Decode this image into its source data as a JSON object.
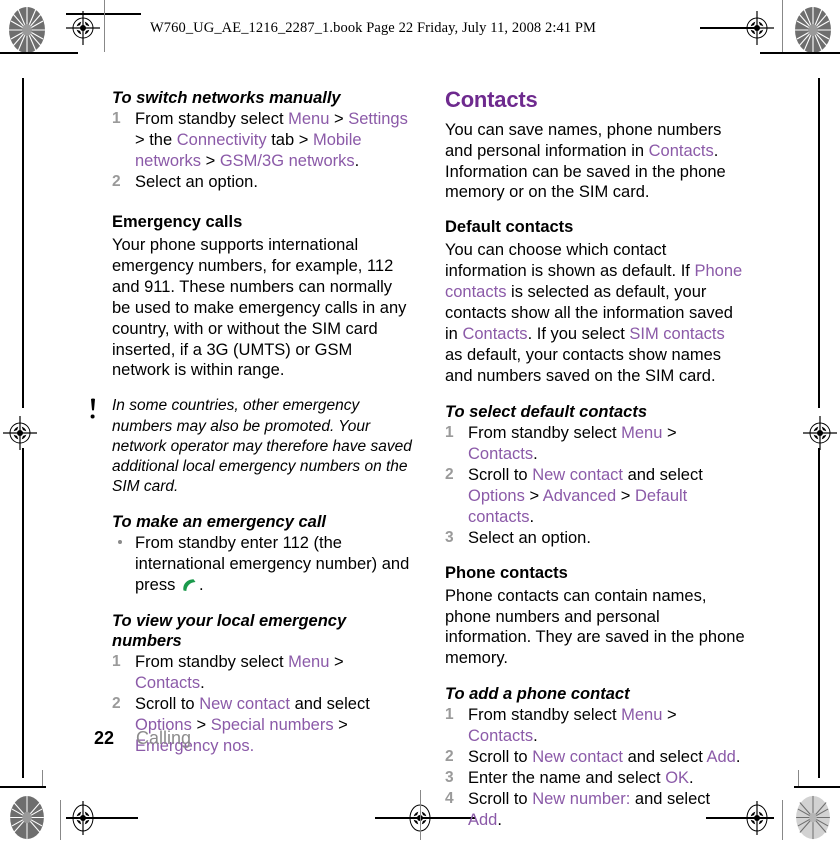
{
  "header": {
    "book_line": "W760_UG_AE_1216_2287_1.book  Page 22  Friday, July 11, 2008  2:41 PM"
  },
  "colors": {
    "heading_purple": "#6e2a8e",
    "link_purple": "#8b5aa8",
    "step_number_gray": "#9a9a9a",
    "footer_gray": "#8c8c8c",
    "call_icon_green": "#1a9a4b"
  },
  "left_column": {
    "proc_switch_networks": {
      "title": "To switch networks manually",
      "steps": [
        {
          "num": "1",
          "parts": [
            {
              "t": "From standby select ",
              "ui": false
            },
            {
              "t": "Menu",
              "ui": true
            },
            {
              "t": " > ",
              "ui": false
            },
            {
              "t": "Settings",
              "ui": true
            },
            {
              "t": " > the ",
              "ui": false
            },
            {
              "t": "Connectivity",
              "ui": true
            },
            {
              "t": " tab > ",
              "ui": false
            },
            {
              "t": "Mobile networks",
              "ui": true
            },
            {
              "t": " > ",
              "ui": false
            },
            {
              "t": "GSM/3G networks",
              "ui": true
            },
            {
              "t": ".",
              "ui": false
            }
          ]
        },
        {
          "num": "2",
          "parts": [
            {
              "t": "Select an option.",
              "ui": false
            }
          ]
        }
      ]
    },
    "emergency_calls": {
      "title": "Emergency calls",
      "body": "Your phone supports international emergency numbers, for example, 112 and 911. These numbers can normally be used to make emergency calls in any country, with or without the SIM card inserted, if a 3G (UMTS) or GSM network is within range."
    },
    "note": {
      "icon": "exclamation-icon",
      "text": "In some countries, other emergency numbers may also be promoted. Your network operator may therefore have saved additional local emergency numbers on the SIM card."
    },
    "proc_make_emergency_call": {
      "title": "To make an emergency call",
      "bullet": {
        "before": "From standby enter 112 (the international emergency number) and press ",
        "icon": "call-key-icon",
        "after": "."
      }
    },
    "proc_view_local_emergency": {
      "title": "To view your local emergency numbers",
      "steps": [
        {
          "num": "1",
          "parts": [
            {
              "t": "From standby select ",
              "ui": false
            },
            {
              "t": "Menu",
              "ui": true
            },
            {
              "t": " > ",
              "ui": false
            },
            {
              "t": "Contacts",
              "ui": true
            },
            {
              "t": ".",
              "ui": false
            }
          ]
        },
        {
          "num": "2",
          "parts": [
            {
              "t": "Scroll to ",
              "ui": false
            },
            {
              "t": "New contact",
              "ui": true
            },
            {
              "t": " and select ",
              "ui": false
            },
            {
              "t": "Options",
              "ui": true
            },
            {
              "t": " > ",
              "ui": false
            },
            {
              "t": "Special numbers",
              "ui": true
            },
            {
              "t": " > ",
              "ui": false
            },
            {
              "t": "Emergency nos.",
              "ui": true
            }
          ]
        }
      ]
    }
  },
  "right_column": {
    "contacts": {
      "title": "Contacts",
      "intro_parts": [
        {
          "t": "You can save names, phone numbers and personal information in ",
          "ui": false
        },
        {
          "t": "Contacts",
          "ui": true
        },
        {
          "t": ". Information can be saved in the phone memory or on the SIM card.",
          "ui": false
        }
      ]
    },
    "default_contacts": {
      "title": "Default contacts",
      "body_parts": [
        {
          "t": "You can choose which contact information is shown as default. If ",
          "ui": false
        },
        {
          "t": "Phone contacts",
          "ui": true
        },
        {
          "t": " is selected as default, your contacts show all the information saved in ",
          "ui": false
        },
        {
          "t": "Contacts",
          "ui": true
        },
        {
          "t": ". If you select ",
          "ui": false
        },
        {
          "t": "SIM contacts",
          "ui": true
        },
        {
          "t": " as default, your contacts show names and numbers saved on the SIM card.",
          "ui": false
        }
      ]
    },
    "proc_select_default_contacts": {
      "title": "To select default contacts",
      "steps": [
        {
          "num": "1",
          "parts": [
            {
              "t": "From standby select ",
              "ui": false
            },
            {
              "t": "Menu",
              "ui": true
            },
            {
              "t": " > ",
              "ui": false
            },
            {
              "t": "Contacts",
              "ui": true
            },
            {
              "t": ".",
              "ui": false
            }
          ]
        },
        {
          "num": "2",
          "parts": [
            {
              "t": "Scroll to ",
              "ui": false
            },
            {
              "t": "New contact",
              "ui": true
            },
            {
              "t": " and select ",
              "ui": false
            },
            {
              "t": "Options",
              "ui": true
            },
            {
              "t": " > ",
              "ui": false
            },
            {
              "t": "Advanced",
              "ui": true
            },
            {
              "t": " > ",
              "ui": false
            },
            {
              "t": "Default contacts",
              "ui": true
            },
            {
              "t": ".",
              "ui": false
            }
          ]
        },
        {
          "num": "3",
          "parts": [
            {
              "t": "Select an option.",
              "ui": false
            }
          ]
        }
      ]
    },
    "phone_contacts": {
      "title": "Phone contacts",
      "body": "Phone contacts can contain names, phone numbers and personal information. They are saved in the phone memory."
    },
    "proc_add_phone_contact": {
      "title": "To add a phone contact",
      "steps": [
        {
          "num": "1",
          "parts": [
            {
              "t": "From standby select ",
              "ui": false
            },
            {
              "t": "Menu",
              "ui": true
            },
            {
              "t": " > ",
              "ui": false
            },
            {
              "t": "Contacts",
              "ui": true
            },
            {
              "t": ".",
              "ui": false
            }
          ]
        },
        {
          "num": "2",
          "parts": [
            {
              "t": "Scroll to ",
              "ui": false
            },
            {
              "t": "New contact",
              "ui": true
            },
            {
              "t": " and select ",
              "ui": false
            },
            {
              "t": "Add",
              "ui": true
            },
            {
              "t": ".",
              "ui": false
            }
          ]
        },
        {
          "num": "3",
          "parts": [
            {
              "t": "Enter the name and select ",
              "ui": false
            },
            {
              "t": "OK",
              "ui": true
            },
            {
              "t": ".",
              "ui": false
            }
          ]
        },
        {
          "num": "4",
          "parts": [
            {
              "t": "Scroll to ",
              "ui": false
            },
            {
              "t": "New number:",
              "ui": true
            },
            {
              "t": " and select ",
              "ui": false
            },
            {
              "t": "Add",
              "ui": true
            },
            {
              "t": ".",
              "ui": false
            }
          ]
        }
      ]
    }
  },
  "footer": {
    "page_number": "22",
    "section": "Calling"
  }
}
